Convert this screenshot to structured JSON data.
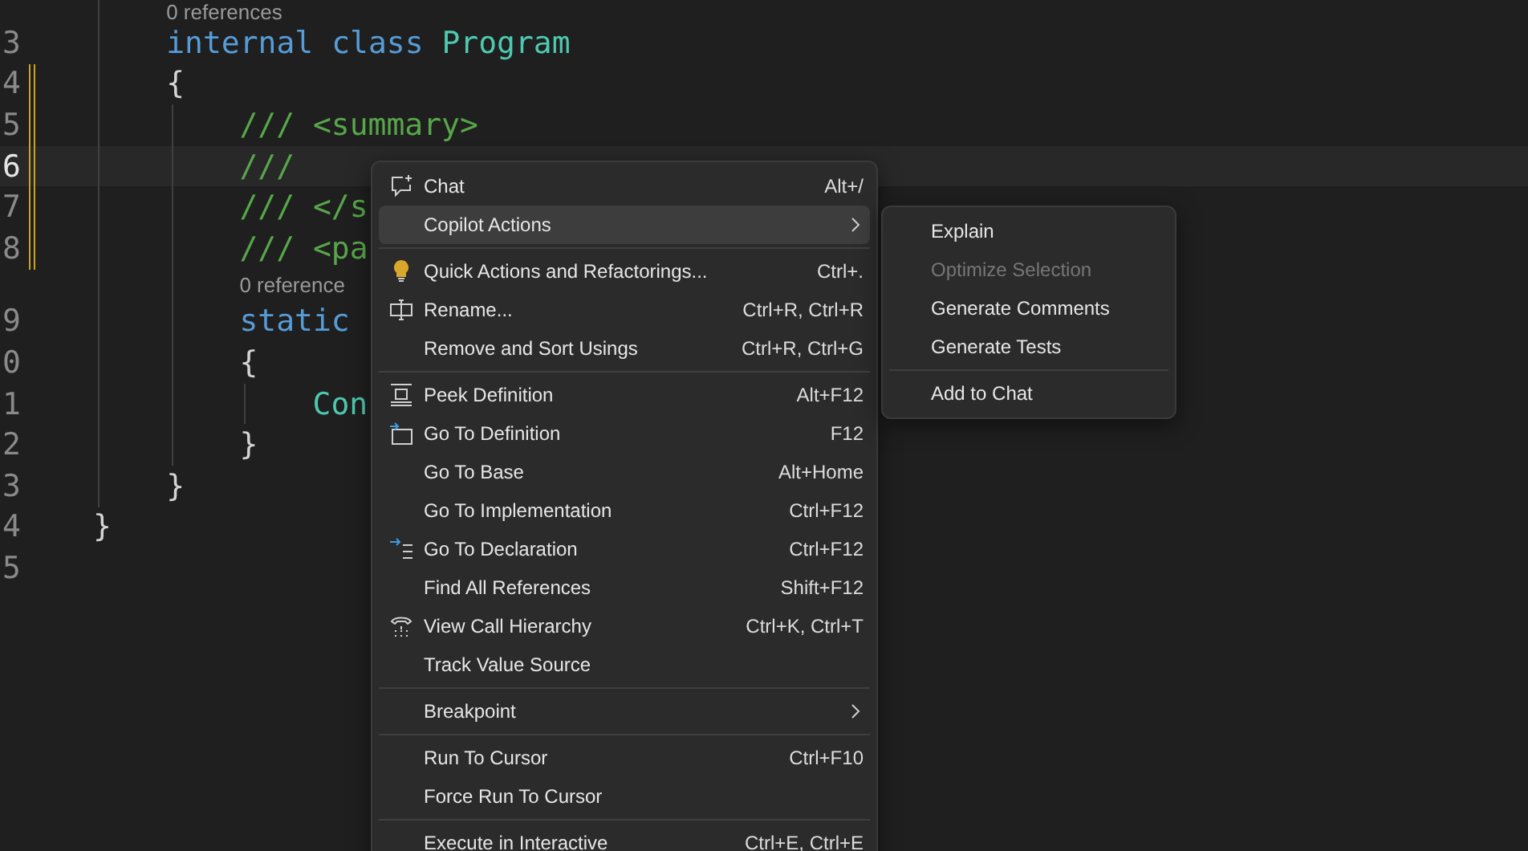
{
  "editor": {
    "lines": [
      {
        "kind": "block",
        "children": [
          {
            "kind": "codelens",
            "text": "0 references"
          },
          {
            "kind": "code",
            "number": "3",
            "changed": false,
            "current": false,
            "tokens": [
              {
                "text": "internal",
                "kind": "keyword"
              },
              {
                "text": "class",
                "kind": "keyword"
              },
              {
                "text": "Program",
                "kind": "type"
              }
            ]
          },
          {
            "kind": "code",
            "number": "4",
            "changed": true,
            "current": false,
            "tokens": [
              {
                "text": "{",
                "kind": "plain"
              }
            ]
          },
          {
            "kind": "block",
            "children": [
              {
                "kind": "code",
                "number": "5",
                "changed": true,
                "current": false,
                "tokens": [
                  {
                    "text": "/// <summary>",
                    "kind": "comment"
                  }
                ]
              },
              {
                "kind": "code",
                "number": "6",
                "changed": true,
                "current": true,
                "tokens": [
                  {
                    "text": "///",
                    "kind": "comment"
                  }
                ]
              },
              {
                "kind": "code",
                "number": "7",
                "changed": true,
                "current": false,
                "tokens": [
                  {
                    "text": "/// </s",
                    "kind": "comment"
                  }
                ]
              },
              {
                "kind": "code",
                "number": "8",
                "changed": true,
                "current": false,
                "tokens": [
                  {
                    "text": "/// <pa",
                    "kind": "comment"
                  }
                ]
              },
              {
                "kind": "codelens",
                "text": "0 reference"
              },
              {
                "kind": "code",
                "number": "9",
                "changed": false,
                "current": false,
                "tokens": [
                  {
                    "text": "static",
                    "kind": "keyword"
                  }
                ]
              },
              {
                "kind": "code",
                "number": "0",
                "changed": false,
                "current": false,
                "tokens": [
                  {
                    "text": "{",
                    "kind": "plain"
                  }
                ]
              },
              {
                "kind": "block",
                "children": [
                  {
                    "kind": "code",
                    "number": "1",
                    "changed": false,
                    "current": false,
                    "tokens": [
                      {
                        "text": "Con",
                        "kind": "type"
                      }
                    ]
                  }
                ]
              },
              {
                "kind": "code",
                "number": "2",
                "changed": false,
                "current": false,
                "tokens": [
                  {
                    "text": "}",
                    "kind": "plain"
                  }
                ]
              }
            ]
          },
          {
            "kind": "code",
            "number": "3",
            "changed": false,
            "current": false,
            "tokens": [
              {
                "text": "}",
                "kind": "plain"
              }
            ]
          }
        ]
      },
      {
        "kind": "code",
        "number": "4",
        "changed": false,
        "current": false,
        "tokens": [
          {
            "text": "}",
            "kind": "plain"
          }
        ]
      },
      {
        "kind": "code",
        "number": "5",
        "changed": false,
        "current": false
      }
    ]
  },
  "context_menu": {
    "items": [
      {
        "kind": "item",
        "label": "Chat",
        "shortcut": "Alt+/",
        "submenu": false,
        "selected": false
      },
      {
        "kind": "item",
        "label": "Copilot Actions",
        "submenu": true,
        "selected": true
      },
      {
        "kind": "separator"
      },
      {
        "kind": "item",
        "label": "Quick Actions and Refactorings...",
        "shortcut": "Ctrl+.",
        "submenu": false,
        "selected": false
      },
      {
        "kind": "item",
        "label": "Rename...",
        "shortcut": "Ctrl+R, Ctrl+R",
        "submenu": false,
        "selected": false
      },
      {
        "kind": "item",
        "label": "Remove and Sort Usings",
        "shortcut": "Ctrl+R, Ctrl+G",
        "submenu": false,
        "selected": false
      },
      {
        "kind": "separator"
      },
      {
        "kind": "item",
        "label": "Peek Definition",
        "shortcut": "Alt+F12",
        "submenu": false,
        "selected": false
      },
      {
        "kind": "item",
        "label": "Go To Definition",
        "shortcut": "F12",
        "submenu": false,
        "selected": false
      },
      {
        "kind": "item",
        "label": "Go To Base",
        "shortcut": "Alt+Home",
        "submenu": false,
        "selected": false
      },
      {
        "kind": "item",
        "label": "Go To Implementation",
        "shortcut": "Ctrl+F12",
        "submenu": false,
        "selected": false
      },
      {
        "kind": "item",
        "label": "Go To Declaration",
        "shortcut": "Ctrl+F12",
        "submenu": false,
        "selected": false
      },
      {
        "kind": "item",
        "label": "Find All References",
        "shortcut": "Shift+F12",
        "submenu": false,
        "selected": false
      },
      {
        "kind": "item",
        "label": "View Call Hierarchy",
        "shortcut": "Ctrl+K, Ctrl+T",
        "submenu": false,
        "selected": false
      },
      {
        "kind": "item",
        "label": "Track Value Source",
        "submenu": false,
        "selected": false
      },
      {
        "kind": "separator"
      },
      {
        "kind": "item",
        "label": "Breakpoint",
        "submenu": true,
        "selected": false
      },
      {
        "kind": "separator"
      },
      {
        "kind": "item",
        "label": "Run To Cursor",
        "shortcut": "Ctrl+F10",
        "submenu": false,
        "selected": false
      },
      {
        "kind": "item",
        "label": "Force Run To Cursor",
        "submenu": false,
        "selected": false
      },
      {
        "kind": "separator"
      },
      {
        "kind": "item",
        "label": "Execute in Interactive",
        "shortcut": "Ctrl+E, Ctrl+E",
        "submenu": false,
        "selected": false
      }
    ]
  },
  "submenu": {
    "items": [
      {
        "kind": "item",
        "label": "Explain",
        "disabled": false
      },
      {
        "kind": "item",
        "label": "Optimize Selection",
        "disabled": true
      },
      {
        "kind": "item",
        "label": "Generate Comments",
        "disabled": false
      },
      {
        "kind": "item",
        "label": "Generate Tests",
        "disabled": false
      },
      {
        "kind": "separator"
      },
      {
        "kind": "item",
        "label": "Add to Chat",
        "disabled": false
      }
    ]
  }
}
